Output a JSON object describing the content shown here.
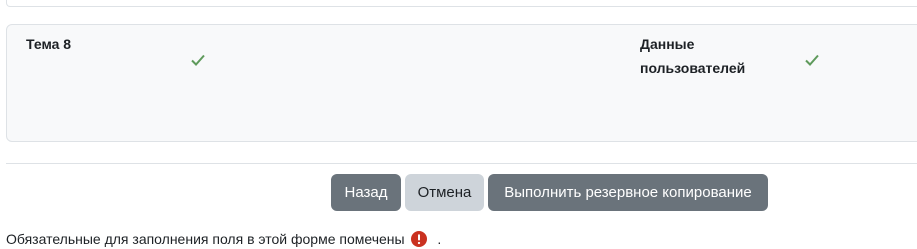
{
  "backup_settings": {
    "items": [
      {
        "label": "Тема 8",
        "checked": true
      },
      {
        "label": "Данные пользователей",
        "checked": true
      }
    ]
  },
  "actions": {
    "back_label": "Назад",
    "cancel_label": "Отмена",
    "backup_label": "Выполнить резервное копирование"
  },
  "footer": {
    "required_text": "Обязательные для заполнения поля в этой форме помечены",
    "required_suffix": ".",
    "required_icon": "exclamation-circle-icon"
  },
  "colors": {
    "check": "#5e9a5b",
    "required_icon": "#ca3120",
    "secondary_button": "#6a737b",
    "cancel_button": "#ced4da"
  }
}
